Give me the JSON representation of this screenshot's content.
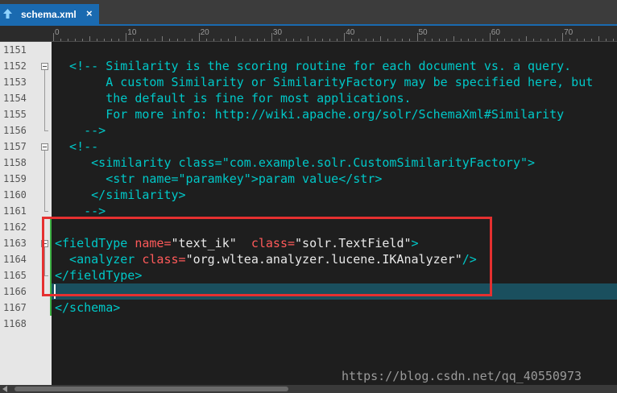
{
  "tab": {
    "label": "schema.xml",
    "close": "×"
  },
  "ruler": {
    "marks": [
      "0",
      "10",
      "20",
      "30",
      "40",
      "50",
      "60",
      "70"
    ]
  },
  "lines": [
    {
      "num": "1151",
      "segs": []
    },
    {
      "num": "1152",
      "segs": [
        {
          "t": "  <!-- Similarity is the scoring routine for each document vs. a query.",
          "c": "cyan"
        }
      ]
    },
    {
      "num": "1153",
      "segs": [
        {
          "t": "       A custom Similarity or SimilarityFactory may be specified here, but",
          "c": "cyan"
        }
      ]
    },
    {
      "num": "1154",
      "segs": [
        {
          "t": "       the default is fine for most applications.",
          "c": "cyan"
        }
      ]
    },
    {
      "num": "1155",
      "segs": [
        {
          "t": "       For more info: http://wiki.apache.org/solr/SchemaXml#Similarity",
          "c": "cyan"
        }
      ]
    },
    {
      "num": "1156",
      "segs": [
        {
          "t": "    -->",
          "c": "cyan"
        }
      ]
    },
    {
      "num": "1157",
      "segs": [
        {
          "t": "  <!--",
          "c": "cyan"
        }
      ]
    },
    {
      "num": "1158",
      "segs": [
        {
          "t": "     <similarity class=\"com.example.solr.CustomSimilarityFactory\">",
          "c": "cyan"
        }
      ]
    },
    {
      "num": "1159",
      "segs": [
        {
          "t": "       <str name=\"paramkey\">param value</str>",
          "c": "cyan"
        }
      ]
    },
    {
      "num": "1160",
      "segs": [
        {
          "t": "     </similarity>",
          "c": "cyan"
        }
      ]
    },
    {
      "num": "1161",
      "segs": [
        {
          "t": "    -->",
          "c": "cyan"
        }
      ]
    },
    {
      "num": "1162",
      "segs": []
    },
    {
      "num": "1163",
      "segs": [
        {
          "t": "<fieldType",
          "c": "cyan"
        },
        {
          "t": " name=",
          "c": "red"
        },
        {
          "t": "\"text_ik\"",
          "c": "white"
        },
        {
          "t": "  class=",
          "c": "red"
        },
        {
          "t": "\"solr.TextField\"",
          "c": "white"
        },
        {
          "t": ">",
          "c": "cyan"
        }
      ]
    },
    {
      "num": "1164",
      "segs": [
        {
          "t": "  <analyzer",
          "c": "cyan"
        },
        {
          "t": " class=",
          "c": "red"
        },
        {
          "t": "\"org.wltea.analyzer.lucene.IKAnalyzer\"",
          "c": "white"
        },
        {
          "t": "/>",
          "c": "cyan"
        }
      ]
    },
    {
      "num": "1165",
      "segs": [
        {
          "t": "</fieldType>",
          "c": "cyan"
        }
      ]
    },
    {
      "num": "1166",
      "segs": []
    },
    {
      "num": "1167",
      "segs": [
        {
          "t": "</schema>",
          "c": "cyan"
        }
      ]
    },
    {
      "num": "1168",
      "segs": []
    }
  ],
  "watermark": "https://blog.csdn.net/qq_40550973",
  "colors": {
    "tab": "#1a6ab0",
    "cyan": "#00c8c8",
    "red": "#ff5a5a",
    "highlight": "#e53030"
  }
}
